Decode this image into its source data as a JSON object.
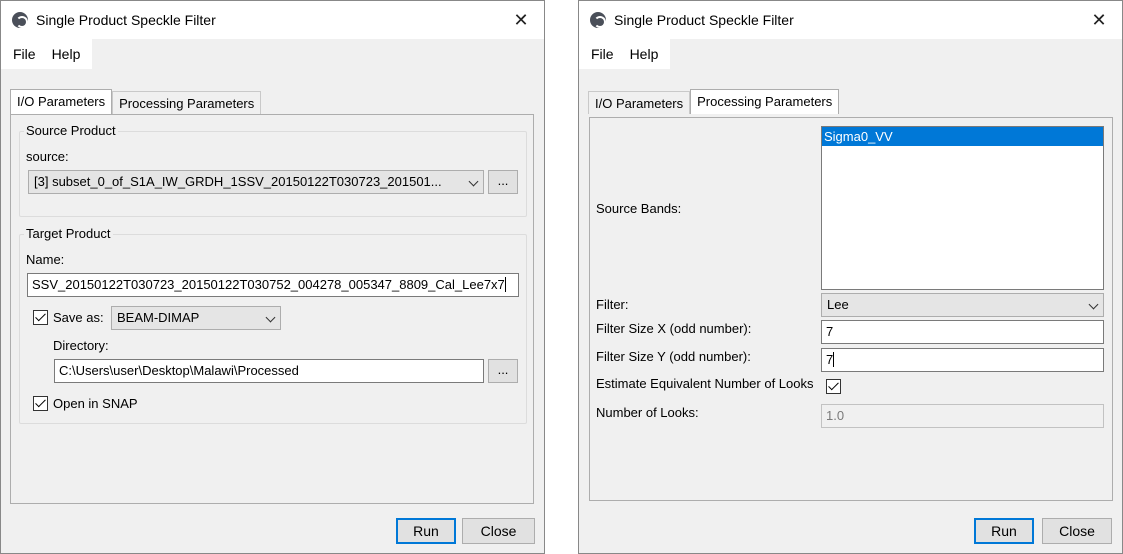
{
  "left_window": {
    "title": "Single Product Speckle Filter",
    "menu": [
      "File",
      "Help"
    ],
    "tabs": [
      "I/O Parameters",
      "Processing Parameters"
    ],
    "active_tab": "I/O Parameters",
    "source_product": {
      "group_title": "Source Product",
      "source_label": "source:",
      "source_value": "[3] subset_0_of_S1A_IW_GRDH_1SSV_20150122T030723_201501...",
      "browse_label": "..."
    },
    "target_product": {
      "group_title": "Target Product",
      "name_label": "Name:",
      "name_value": "SSV_20150122T030723_20150122T030752_004278_005347_8809_Cal_Lee7x7",
      "save_as_label": "Save as:",
      "save_as_checked": true,
      "format_value": "BEAM-DIMAP",
      "directory_label": "Directory:",
      "directory_value": "C:\\Users\\user\\Desktop\\Malawi\\Processed",
      "browse_label": "...",
      "open_in_snap_label": "Open in SNAP",
      "open_in_snap_checked": true
    },
    "buttons": {
      "run": "Run",
      "close": "Close"
    }
  },
  "right_window": {
    "title": "Single Product Speckle Filter",
    "menu": [
      "File",
      "Help"
    ],
    "tabs": [
      "I/O Parameters",
      "Processing Parameters"
    ],
    "active_tab": "Processing Parameters",
    "source_bands_label": "Source Bands:",
    "source_bands": [
      "Sigma0_VV"
    ],
    "filter_label": "Filter:",
    "filter_value": "Lee",
    "filter_size_x_label": "Filter Size X (odd number):",
    "filter_size_x_value": "7",
    "filter_size_y_label": "Filter Size Y (odd number):",
    "filter_size_y_value": "7",
    "estimate_enl_label": "Estimate Equivalent Number of Looks",
    "estimate_enl_checked": true,
    "num_looks_label": "Number of Looks:",
    "num_looks_value": "1.0",
    "buttons": {
      "run": "Run",
      "close": "Close"
    }
  }
}
